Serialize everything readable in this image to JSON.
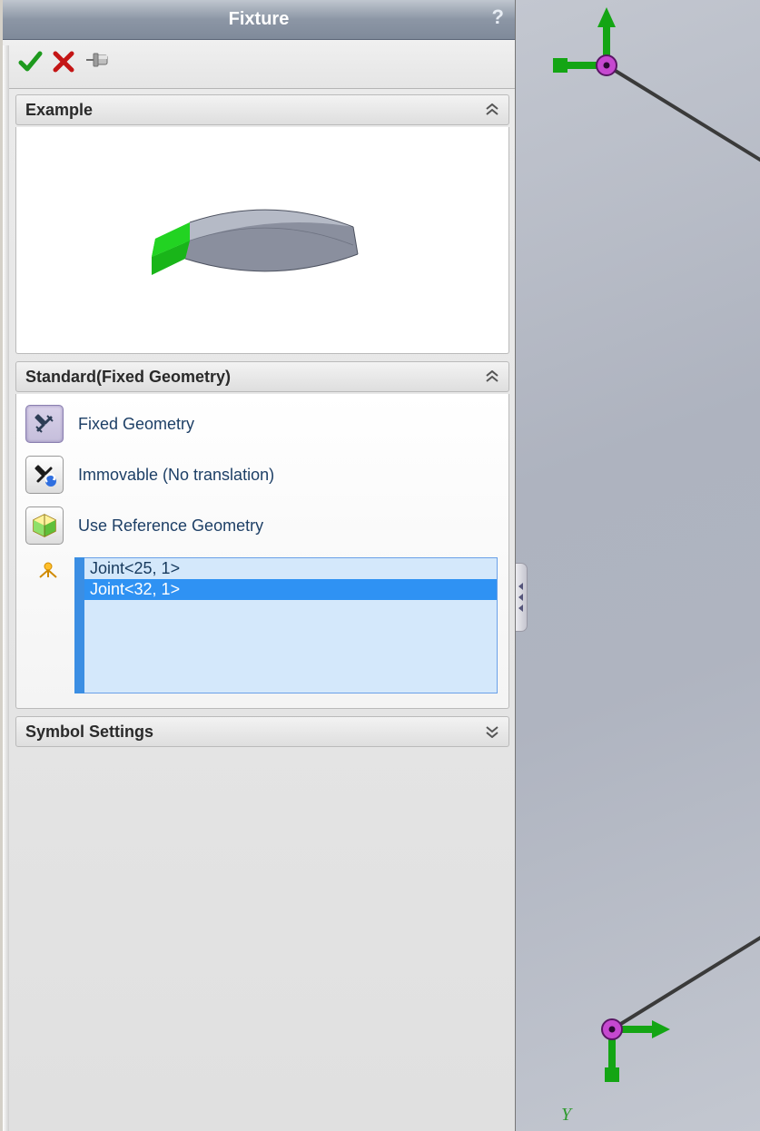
{
  "titlebar": {
    "title": "Fixture",
    "help": "?"
  },
  "sections": {
    "example": {
      "title": "Example"
    },
    "standard": {
      "title": "Standard(Fixed Geometry)",
      "options": {
        "fixed": "Fixed Geometry",
        "immovable": "Immovable (No translation)",
        "reference": "Use Reference Geometry"
      },
      "selection": {
        "items": [
          "Joint<25, 1>",
          "Joint<32, 1>"
        ],
        "selected_index": 1
      }
    },
    "symbol": {
      "title": "Symbol Settings"
    }
  },
  "viewport": {
    "axis_label": "Y"
  }
}
